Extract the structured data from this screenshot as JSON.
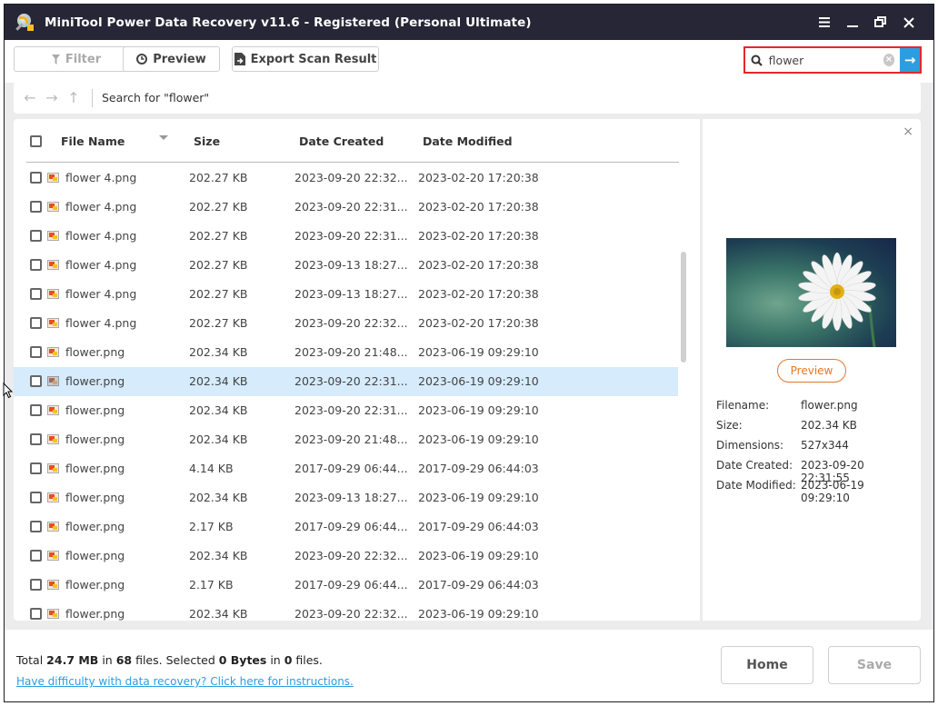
{
  "window": {
    "title": "MiniTool Power Data Recovery v11.6 - Registered (Personal Ultimate)",
    "controls": [
      "menu-icon",
      "minimize-icon",
      "restore-icon",
      "close-icon"
    ]
  },
  "toolbar": {
    "filter_label": "Filter",
    "preview_label": "Preview",
    "export_label": "Export Scan Result",
    "search_value": "flower",
    "search_placeholder": "",
    "clear_glyph": "×",
    "go_glyph": "→"
  },
  "navbar": {
    "back_glyph": "←",
    "forward_glyph": "→",
    "up_glyph": "↑",
    "search_for_label": "Search for  \"flower\""
  },
  "list": {
    "columns": [
      "File Name",
      "Size",
      "Date Created",
      "Date Modified"
    ],
    "rows": [
      {
        "name": "flower 4.png",
        "size": "202.27 KB",
        "created": "2023-09-20 22:32...",
        "modified": "2023-02-20 17:20:38"
      },
      {
        "name": "flower 4.png",
        "size": "202.27 KB",
        "created": "2023-09-20 22:31...",
        "modified": "2023-02-20 17:20:38"
      },
      {
        "name": "flower 4.png",
        "size": "202.27 KB",
        "created": "2023-09-20 22:31...",
        "modified": "2023-02-20 17:20:38"
      },
      {
        "name": "flower 4.png",
        "size": "202.27 KB",
        "created": "2023-09-13 18:27...",
        "modified": "2023-02-20 17:20:38"
      },
      {
        "name": "flower 4.png",
        "size": "202.27 KB",
        "created": "2023-09-13 18:27...",
        "modified": "2023-02-20 17:20:38"
      },
      {
        "name": "flower 4.png",
        "size": "202.27 KB",
        "created": "2023-09-20 22:32...",
        "modified": "2023-02-20 17:20:38"
      },
      {
        "name": "flower.png",
        "size": "202.34 KB",
        "created": "2023-09-20 21:48...",
        "modified": "2023-06-19 09:29:10"
      },
      {
        "name": "flower.png",
        "size": "202.34 KB",
        "created": "2023-09-20 22:31...",
        "modified": "2023-06-19 09:29:10",
        "selected": true
      },
      {
        "name": "flower.png",
        "size": "202.34 KB",
        "created": "2023-09-20 22:31...",
        "modified": "2023-06-19 09:29:10"
      },
      {
        "name": "flower.png",
        "size": "202.34 KB",
        "created": "2023-09-20 21:48...",
        "modified": "2023-06-19 09:29:10"
      },
      {
        "name": "flower.png",
        "size": "4.14 KB",
        "created": "2017-09-29 06:44...",
        "modified": "2017-09-29 06:44:03"
      },
      {
        "name": "flower.png",
        "size": "202.34 KB",
        "created": "2023-09-13 18:27...",
        "modified": "2023-06-19 09:29:10"
      },
      {
        "name": "flower.png",
        "size": "2.17 KB",
        "created": "2017-09-29 06:44...",
        "modified": "2017-09-29 06:44:03"
      },
      {
        "name": "flower.png",
        "size": "202.34 KB",
        "created": "2023-09-20 22:32...",
        "modified": "2023-06-19 09:29:10"
      },
      {
        "name": "flower.png",
        "size": "2.17 KB",
        "created": "2017-09-29 06:44...",
        "modified": "2017-09-29 06:44:03"
      },
      {
        "name": "flower.png",
        "size": "202.34 KB",
        "created": "2023-09-20 22:32...",
        "modified": "2023-06-19 09:29:10"
      }
    ]
  },
  "preview": {
    "close_glyph": "×",
    "preview_button": "Preview",
    "meta": [
      {
        "key": "Filename:",
        "value": "flower.png"
      },
      {
        "key": "Size:",
        "value": "202.34 KB"
      },
      {
        "key": "Dimensions:",
        "value": "527x344"
      },
      {
        "key": "Date Created:",
        "value": "2023-09-20 22:31:55"
      },
      {
        "key": "Date Modified:",
        "value": "2023-06-19 09:29:10"
      }
    ]
  },
  "footer": {
    "total_prefix": "Total ",
    "total_size": "24.7 MB",
    "in1": " in ",
    "total_files": "68",
    "files1": " files.  Selected ",
    "selected_size": "0 Bytes",
    "in2": " in ",
    "selected_files": "0",
    "files2": " files.",
    "help_link": "Have difficulty with data recovery? Click here for instructions.",
    "home_label": "Home",
    "save_label": "Save"
  },
  "colors": {
    "titlebar": "#262636",
    "accent_blue": "#2a9ee0",
    "search_highlight": "#e8262c",
    "preview_orange": "#e2792b",
    "selected_row": "#d6ebfb"
  }
}
